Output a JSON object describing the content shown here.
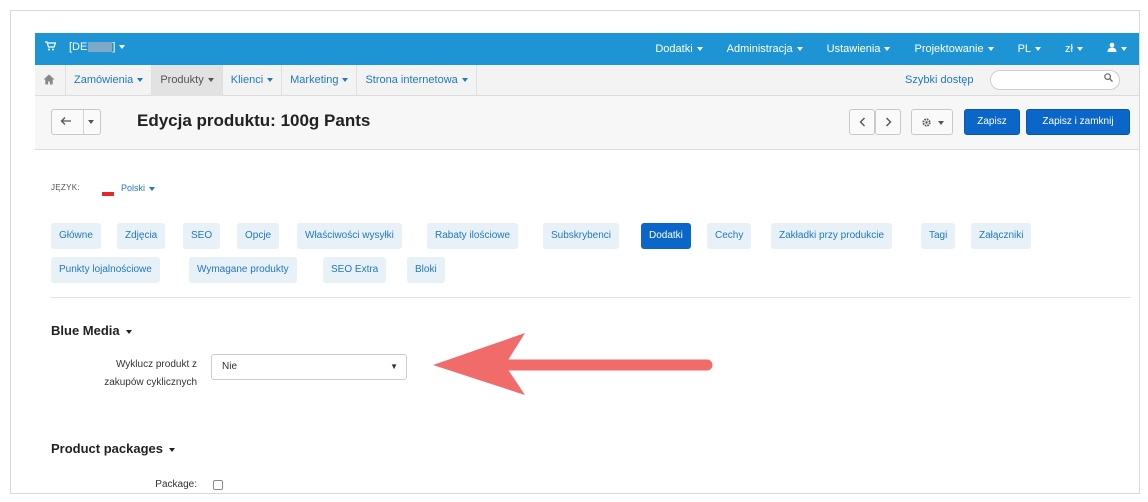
{
  "topbar": {
    "cart_icon": "cart-icon",
    "store_label": "[DE",
    "menu": [
      "Dodatki",
      "Administracja",
      "Ustawienia",
      "Projektowanie",
      "PL",
      "zł"
    ],
    "user_icon": "user-icon",
    "color": "#1e94d5"
  },
  "secbar": {
    "home_icon": "home-icon",
    "nav": [
      "Zamówienia",
      "Produkty",
      "Klienci",
      "Marketing",
      "Strona internetowa"
    ],
    "quick_access": "Szybki dostęp",
    "search_placeholder": "",
    "search_icon": "magnifier-icon"
  },
  "toolbar": {
    "back_icon": "back-arrow-icon",
    "title": "Edycja produktu: 100g Pants",
    "prev_icon": "chevron-left-icon",
    "next_icon": "chevron-right-icon",
    "gear_icon": "gear-icon",
    "save": "Zapisz",
    "save_close": "Zapisz i zamknij"
  },
  "language": {
    "label": "JĘZYK:",
    "value": "Polski"
  },
  "tabs": {
    "row1": [
      "Główne",
      "Zdjęcia",
      "SEO",
      "Opcje",
      "Właściwości wysyłki",
      "Rabaty ilościowe",
      "Subskrybenci",
      "Dodatki",
      "Cechy",
      "Zakładki przy produkcie",
      "Tagi",
      "Załączniki"
    ],
    "row2": [
      "Punkty lojalnościowe",
      "Wymagane produkty",
      "SEO Extra",
      "Bloki"
    ],
    "active": "Dodatki"
  },
  "blue_media": {
    "title": "Blue Media",
    "field_label_line1": "Wyklucz produkt z",
    "field_label_line2": "zakupów cyklicznych",
    "field_value": "Nie"
  },
  "packages": {
    "title": "Product packages",
    "field_label": "Package:",
    "checked": false
  },
  "annotation": {
    "arrow_color": "#f26b6b"
  }
}
